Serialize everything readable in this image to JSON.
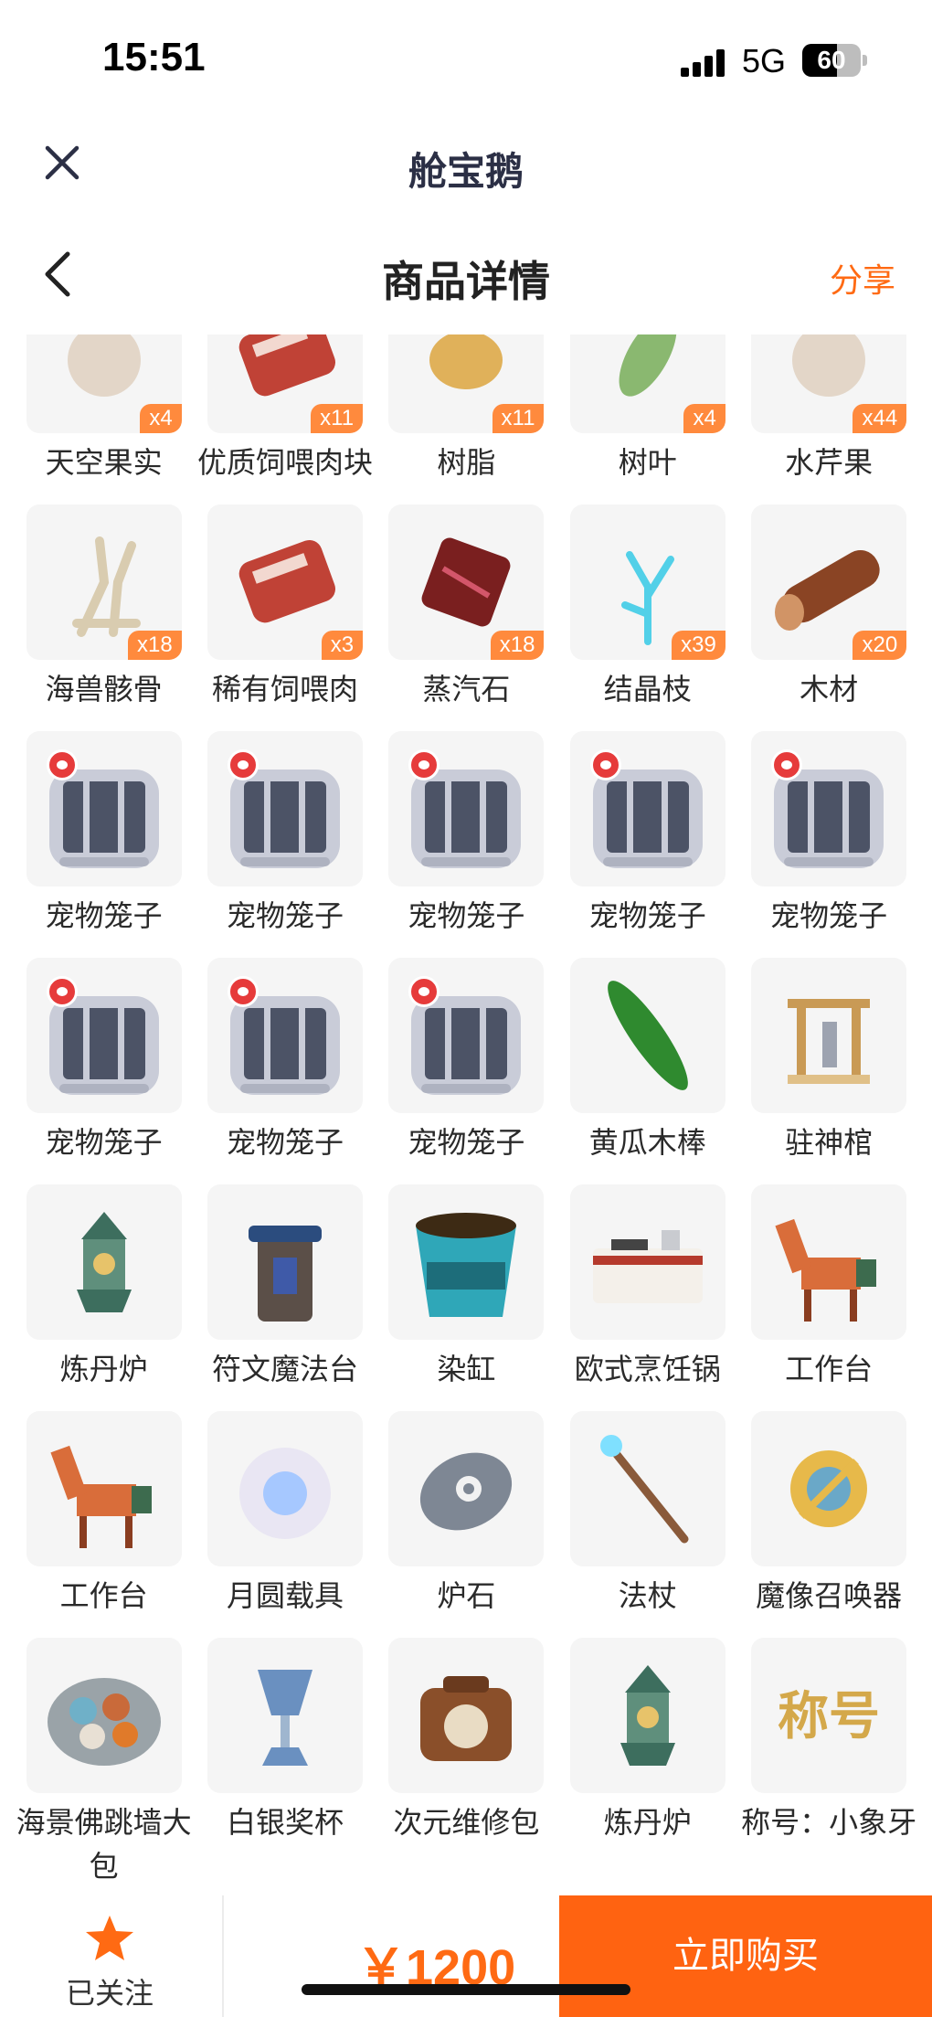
{
  "status_bar": {
    "time": "15:51",
    "network": "5G",
    "battery": "60",
    "battery_level": 0.6
  },
  "mini_app": {
    "title": "舱宝鹅"
  },
  "nav": {
    "title": "商品详情",
    "share_label": "分享"
  },
  "rows": [
    {
      "items": [
        {
          "label": "天空果实",
          "qty": "x4",
          "icon": "fruit"
        },
        {
          "label": "优质饲喂肉块",
          "qty": "x11",
          "icon": "meat"
        },
        {
          "label": "树脂",
          "qty": "x11",
          "icon": "resin"
        },
        {
          "label": "树叶",
          "qty": "x4",
          "icon": "leaf"
        },
        {
          "label": "水芹果",
          "qty": "x44",
          "icon": "fruit"
        }
      ]
    },
    {
      "items": [
        {
          "label": "海兽骸骨",
          "qty": "x18",
          "icon": "bone"
        },
        {
          "label": "稀有饲喂肉",
          "qty": "x3",
          "icon": "meat"
        },
        {
          "label": "蒸汽石",
          "qty": "x18",
          "icon": "steam-stone"
        },
        {
          "label": "结晶枝",
          "qty": "x39",
          "icon": "crystal-branch"
        },
        {
          "label": "木材",
          "qty": "x20",
          "icon": "log"
        }
      ]
    },
    {
      "items": [
        {
          "label": "宠物笼子",
          "qty": "",
          "icon": "pet-cage"
        },
        {
          "label": "宠物笼子",
          "qty": "",
          "icon": "pet-cage"
        },
        {
          "label": "宠物笼子",
          "qty": "",
          "icon": "pet-cage"
        },
        {
          "label": "宠物笼子",
          "qty": "",
          "icon": "pet-cage"
        },
        {
          "label": "宠物笼子",
          "qty": "",
          "icon": "pet-cage"
        }
      ]
    },
    {
      "items": [
        {
          "label": "宠物笼子",
          "qty": "",
          "icon": "pet-cage"
        },
        {
          "label": "宠物笼子",
          "qty": "",
          "icon": "pet-cage"
        },
        {
          "label": "宠物笼子",
          "qty": "",
          "icon": "pet-cage"
        },
        {
          "label": "黄瓜木棒",
          "qty": "",
          "icon": "cucumber"
        },
        {
          "label": "驻神棺",
          "qty": "",
          "icon": "shrine"
        }
      ]
    },
    {
      "items": [
        {
          "label": "炼丹炉",
          "qty": "",
          "icon": "lantern"
        },
        {
          "label": "符文魔法台",
          "qty": "",
          "icon": "rune-altar"
        },
        {
          "label": "染缸",
          "qty": "",
          "icon": "dye-vat"
        },
        {
          "label": "欧式烹饪锅",
          "qty": "",
          "icon": "stove"
        },
        {
          "label": "工作台",
          "qty": "",
          "icon": "horse-bench"
        }
      ]
    },
    {
      "items": [
        {
          "label": "工作台",
          "qty": "",
          "icon": "horse-bench"
        },
        {
          "label": "月圆载具",
          "qty": "",
          "icon": "moon-cloud"
        },
        {
          "label": "炉石",
          "qty": "",
          "icon": "hearthstone"
        },
        {
          "label": "法杖",
          "qty": "",
          "icon": "staff"
        },
        {
          "label": "魔像召唤器",
          "qty": "",
          "icon": "golem-summoner"
        }
      ]
    },
    {
      "items": [
        {
          "label": "海景佛跳墙大包",
          "qty": "",
          "icon": "food-plate"
        },
        {
          "label": "白银奖杯",
          "qty": "",
          "icon": "trophy"
        },
        {
          "label": "次元维修包",
          "qty": "",
          "icon": "repair-bag"
        },
        {
          "label": "炼丹炉",
          "qty": "",
          "icon": "lantern"
        },
        {
          "label": "称号：小象牙",
          "qty": "",
          "icon": "title-badge"
        }
      ]
    }
  ],
  "bottom": {
    "follow_label": "已关注",
    "price": "￥1200",
    "buy_label": "立即购买"
  },
  "colors": {
    "accent": "#ff6a13",
    "buy": "#ff6311",
    "qty_badge": "#ff8a3d",
    "tile_bg": "#f5f5f5"
  },
  "badge_label": "称号"
}
